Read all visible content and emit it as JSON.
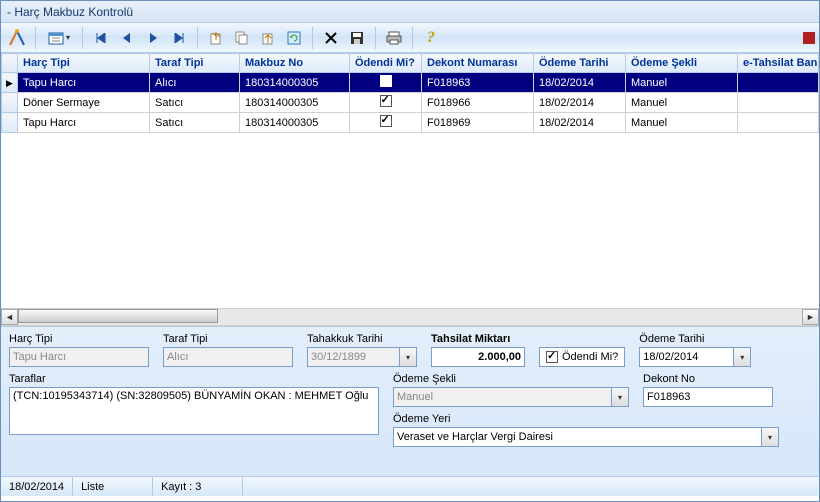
{
  "window": {
    "title": " - Harç Makbuz Kontrolü"
  },
  "grid": {
    "columns": [
      "Harç Tipi",
      "Taraf Tipi",
      "Makbuz No",
      "Ödendi Mi?",
      "Dekont Numarası",
      "Ödeme Tarihi",
      "Ödeme Şekli",
      "e-Tahsilat Bankası"
    ],
    "rows": [
      {
        "harc": "Tapu Harcı",
        "taraf": "Alıcı",
        "makbuz": "180314000305",
        "odendi": true,
        "dekont": "F018963",
        "tarih": "18/02/2014",
        "sekil": "Manuel",
        "banka": ""
      },
      {
        "harc": "Döner Sermaye",
        "taraf": "Satıcı",
        "makbuz": "180314000305",
        "odendi": true,
        "dekont": "F018966",
        "tarih": "18/02/2014",
        "sekil": "Manuel",
        "banka": ""
      },
      {
        "harc": "Tapu Harcı",
        "taraf": "Satıcı",
        "makbuz": "180314000305",
        "odendi": true,
        "dekont": "F018969",
        "tarih": "18/02/2014",
        "sekil": "Manuel",
        "banka": ""
      }
    ],
    "selected_index": 0
  },
  "detail": {
    "labels": {
      "harc_tipi": "Harç Tipi",
      "taraf_tipi": "Taraf Tipi",
      "tahakkuk_tarihi": "Tahakkuk Tarihi",
      "tahsilat_miktari": "Tahsilat Miktarı",
      "odendi_mi": "Ödendi Mi?",
      "odeme_tarihi": "Ödeme Tarihi",
      "taraflar": "Taraflar",
      "odeme_sekli": "Ödeme Şekli",
      "dekont_no": "Dekont No",
      "odeme_yeri": "Ödeme Yeri"
    },
    "values": {
      "harc_tipi": "Tapu Harcı",
      "taraf_tipi": "Alıcı",
      "tahakkuk_tarihi": "30/12/1899",
      "tahsilat_miktari": "2.000,00",
      "odendi_mi": true,
      "odeme_tarihi": "18/02/2014",
      "taraflar": "(TCN:10195343714) (SN:32809505) BÜNYAMİN OKAN : MEHMET Oğlu",
      "odeme_sekli": "Manuel",
      "dekont_no": "F018963",
      "odeme_yeri": "Veraset ve Harçlar Vergi Dairesi"
    }
  },
  "status": {
    "date": "18/02/2014",
    "mode": "Liste",
    "record": "Kayıt : 3"
  }
}
